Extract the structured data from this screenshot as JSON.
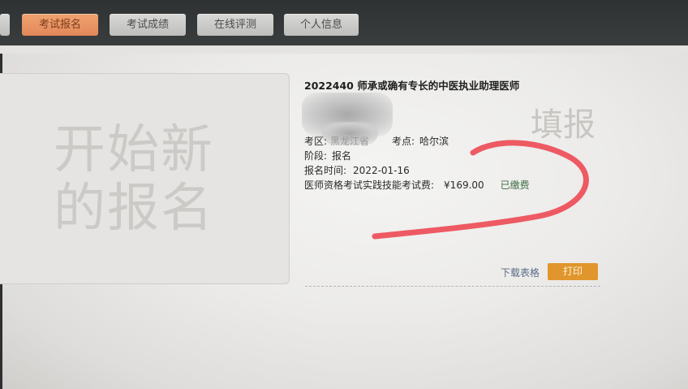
{
  "nav": {
    "tabs": [
      {
        "label": "考试报名",
        "active": true
      },
      {
        "label": "考试成绩",
        "active": false
      },
      {
        "label": "在线评测",
        "active": false
      },
      {
        "label": "个人信息",
        "active": false
      }
    ]
  },
  "new_registration": {
    "line1": "开始新",
    "line2": "的报名"
  },
  "registration": {
    "title": "2022440 师承或确有专长的中医执业助理医师",
    "region_label": "考区:",
    "region_value": "黑龙江省",
    "site_label": "考点:",
    "site_value": "哈尔滨",
    "stage_label": "阶段:",
    "stage_value": "报名",
    "time_label": "报名时间:",
    "time_value": "2022-01-16",
    "fee_label": "医师资格考试实践技能考试费:",
    "fee_value": "¥169.00",
    "fee_status": "已缴费",
    "watermark": "填报",
    "download_label": "下载表格",
    "print_label": "打印"
  },
  "colors": {
    "accent": "#e0962c",
    "active_tab": "#e2875a",
    "paid": "#3e6e46",
    "scribble": "#ee5a63"
  }
}
